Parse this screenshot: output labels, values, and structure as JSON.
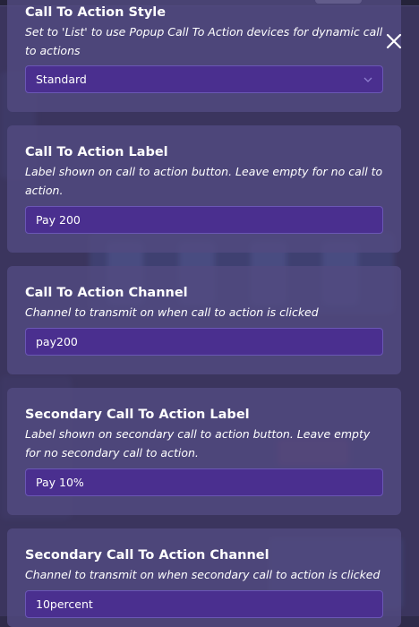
{
  "panels": [
    {
      "title": "Call To Action Style",
      "description": "Set to 'List' to use Popup Call To Action devices for dynamic call to actions",
      "value": "Standard",
      "kind": "select"
    },
    {
      "title": "Call To Action Label",
      "description": "Label shown on call to action button. Leave empty for no call to action.",
      "value": "Pay 200",
      "kind": "text"
    },
    {
      "title": "Call To Action Channel",
      "description": "Channel to transmit on when call to action is clicked",
      "value": "pay200",
      "kind": "text"
    },
    {
      "title": "Secondary Call To Action Label",
      "description": "Label shown on secondary call to action button. Leave empty for no secondary call to action.",
      "value": "Pay 10%",
      "kind": "text"
    },
    {
      "title": "Secondary Call To Action Channel",
      "description": "Channel to transmit on when secondary call to action is clicked",
      "value": "10percent",
      "kind": "text"
    }
  ],
  "icons": {
    "close": "close-icon",
    "dropdown": "chevron-down-icon"
  },
  "colors": {
    "panel": "#524a80",
    "field": "#4a2f8f",
    "field_border": "#6b57b5",
    "text": "#ffffff"
  }
}
